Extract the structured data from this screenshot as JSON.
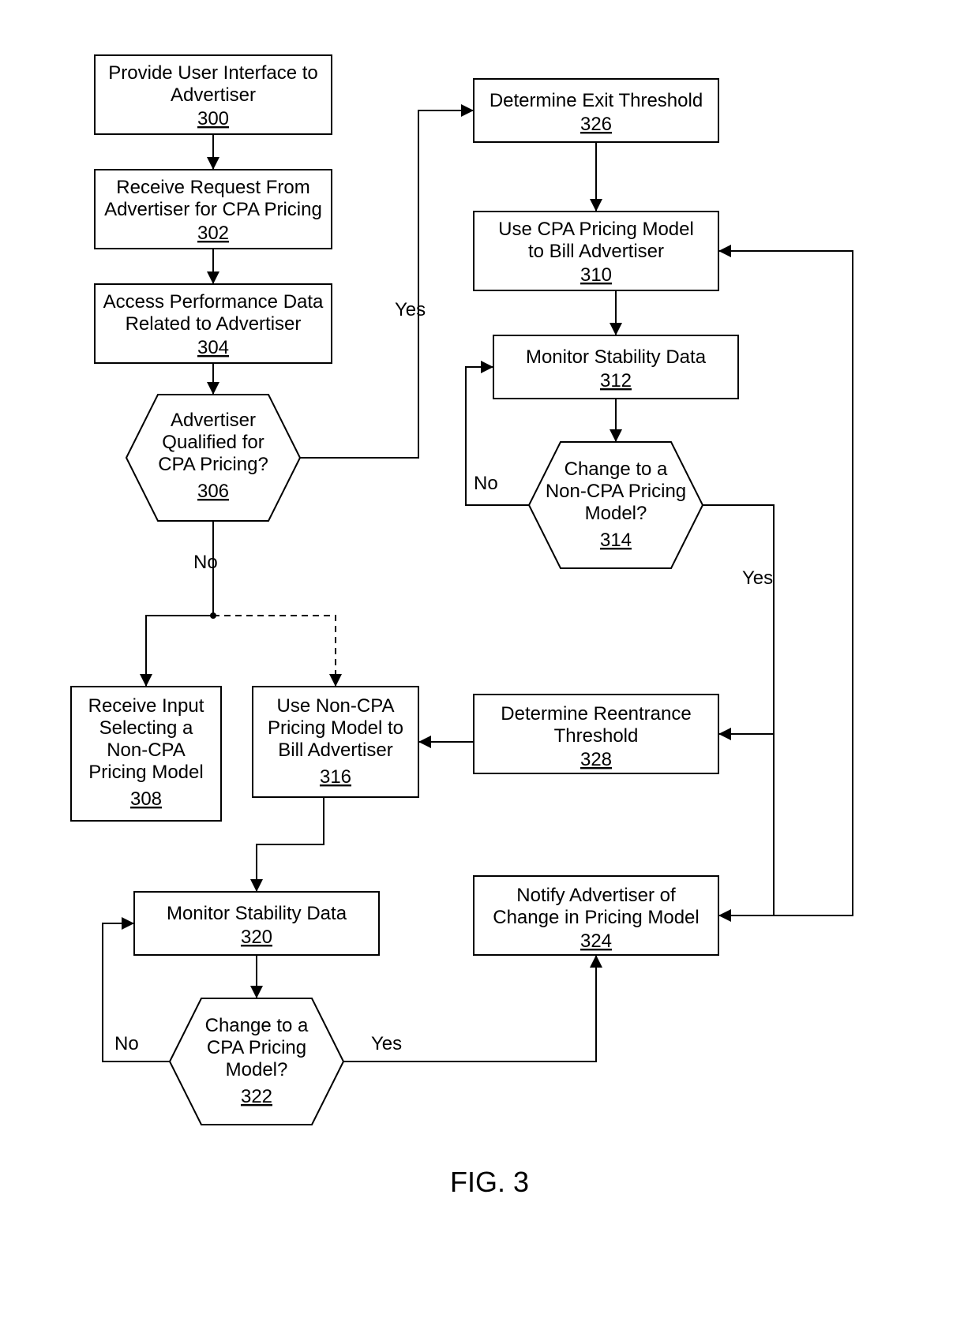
{
  "figure_label": "FIG. 3",
  "nodes": {
    "n300": {
      "lines": [
        "Provide User Interface to",
        "Advertiser"
      ],
      "ref": "300"
    },
    "n302": {
      "lines": [
        "Receive Request From",
        "Advertiser for CPA Pricing"
      ],
      "ref": "302"
    },
    "n304": {
      "lines": [
        "Access Performance Data",
        "Related to Advertiser"
      ],
      "ref": "304"
    },
    "n306": {
      "lines": [
        "Advertiser",
        "Qualified for",
        "CPA Pricing?"
      ],
      "ref": "306"
    },
    "n308": {
      "lines": [
        "Receive Input",
        "Selecting a",
        "Non-CPA",
        "Pricing Model"
      ],
      "ref": "308"
    },
    "n310": {
      "lines": [
        "Use CPA Pricing Model",
        "to Bill Advertiser"
      ],
      "ref": "310"
    },
    "n312": {
      "lines": [
        "Monitor Stability Data"
      ],
      "ref": "312"
    },
    "n314": {
      "lines": [
        "Change to a",
        "Non-CPA  Pricing",
        "Model?"
      ],
      "ref": "314"
    },
    "n316": {
      "lines": [
        "Use Non-CPA",
        "Pricing Model to",
        "Bill Advertiser"
      ],
      "ref": "316"
    },
    "n320": {
      "lines": [
        "Monitor Stability Data"
      ],
      "ref": "320"
    },
    "n322": {
      "lines": [
        "Change to a",
        "CPA Pricing",
        "Model?"
      ],
      "ref": "322"
    },
    "n324": {
      "lines": [
        "Notify Advertiser of",
        "Change in Pricing Model"
      ],
      "ref": "324"
    },
    "n326": {
      "lines": [
        "Determine Exit Threshold"
      ],
      "ref": "326"
    },
    "n328": {
      "lines": [
        "Determine Reentrance",
        "Threshold"
      ],
      "ref": "328"
    }
  },
  "edge_labels": {
    "yes306": "Yes",
    "no306": "No",
    "no314": "No",
    "yes314": "Yes",
    "no322": "No",
    "yes322": "Yes"
  }
}
